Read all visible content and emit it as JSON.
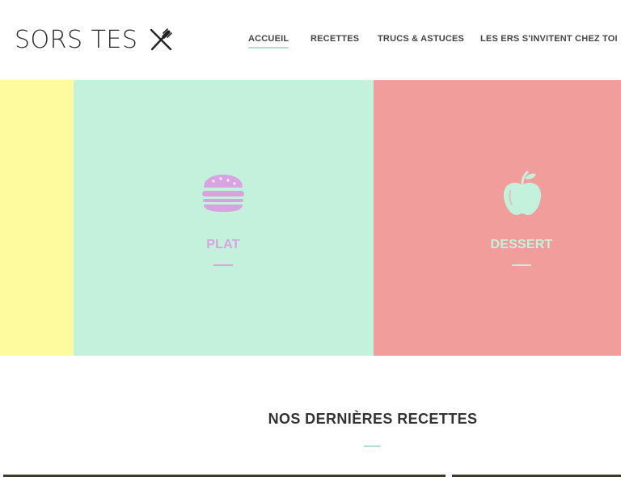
{
  "site": {
    "logo_text": "SORS TES",
    "logo_icon": "knife-fork-icon"
  },
  "nav": {
    "items": [
      {
        "label": "ACCUEIL",
        "active": true
      },
      {
        "label": "RECETTES",
        "active": false
      },
      {
        "label": "TRUCS & ASTUCES",
        "active": false
      },
      {
        "label": "LES ERS S'INVITENT CHEZ TOI",
        "active": false
      }
    ]
  },
  "hero": {
    "panels": [
      {
        "label": "",
        "icon": "",
        "color": "#fefa9e"
      },
      {
        "label": "PLAT",
        "icon": "burger-icon",
        "color": "#c3f1dc",
        "accent": "#d7a3e0"
      },
      {
        "label": "DESSERT",
        "icon": "apple-icon",
        "color": "#f09d9c",
        "accent": "#c3f1dc"
      }
    ]
  },
  "section": {
    "title": "NOS DERNIÈRES RECETTES"
  },
  "colors": {
    "brand_accent": "#a9e3cf",
    "text": "#333333"
  }
}
